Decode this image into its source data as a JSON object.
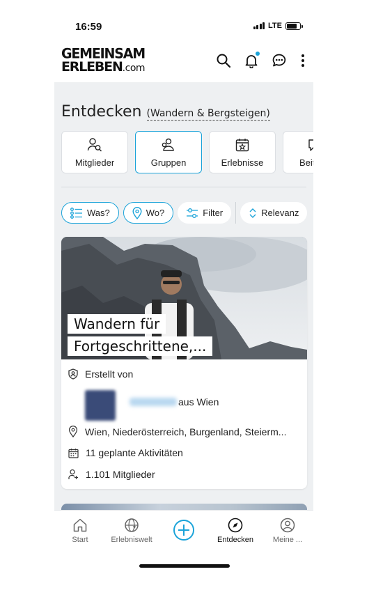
{
  "status": {
    "time": "16:59",
    "network": "LTE"
  },
  "logo": {
    "line1": "GEMEINSAM",
    "line2": "ERLEBEN",
    "domain": ".com"
  },
  "header_icons": [
    "search-icon",
    "bell-icon",
    "chat-icon",
    "more-vertical-icon"
  ],
  "page": {
    "title": "Entdecken",
    "subtitle": "(Wandern & Bergsteigen)"
  },
  "tabs": [
    {
      "label": "Mitglieder",
      "icon": "members-search-icon",
      "active": false
    },
    {
      "label": "Gruppen",
      "icon": "groups-icon",
      "active": true
    },
    {
      "label": "Erlebnisse",
      "icon": "calendar-star-icon",
      "active": false
    },
    {
      "label": "Beit",
      "icon": "comment-icon",
      "active": false
    }
  ],
  "chips": {
    "was": "Was?",
    "wo": "Wo?",
    "filter": "Filter",
    "relevanz": "Relevanz"
  },
  "card": {
    "title_line1": "Wandern für",
    "title_line2": "Fortgeschrittene,...",
    "created_by_label": "Erstellt von",
    "creator_location": "aus Wien",
    "location": "Wien, Niederösterreich, Burgenland, Steierm...",
    "activities": "11 geplante Aktivitäten",
    "members": "1.101 Mitglieder"
  },
  "nav": [
    {
      "label": "Start",
      "icon": "home-icon",
      "active": false
    },
    {
      "label": "Erlebniswelt",
      "icon": "globe-icon",
      "active": false
    },
    {
      "label": "",
      "icon": "add-circle-icon",
      "active": false
    },
    {
      "label": "Entdecken",
      "icon": "compass-icon",
      "active": true
    },
    {
      "label": "Meine ...",
      "icon": "profile-icon",
      "active": false
    }
  ],
  "colors": {
    "accent": "#1aa3d9",
    "background": "#eef0f2"
  }
}
